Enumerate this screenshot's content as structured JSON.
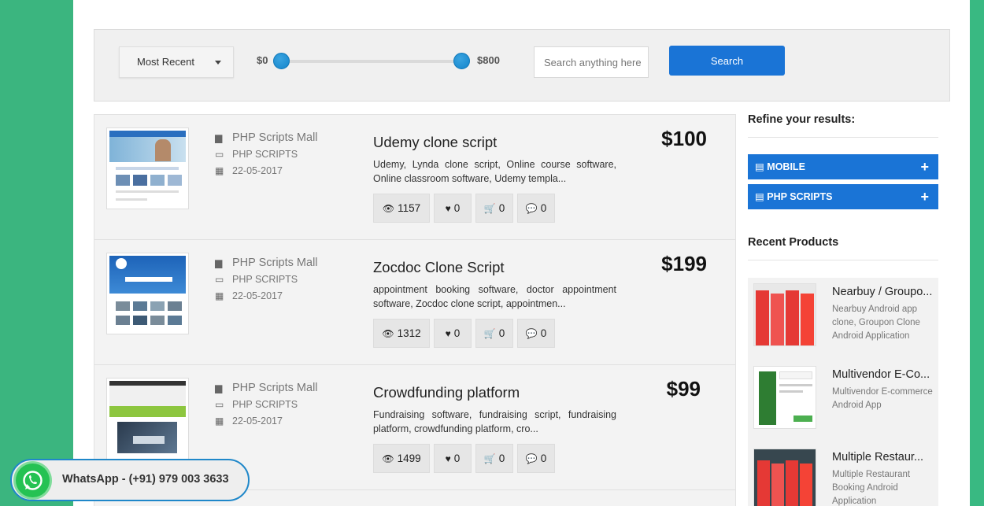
{
  "filters": {
    "sort_selected": "Most Recent",
    "price_min": "$0",
    "price_max": "$800",
    "price_range_fraction": [
      0,
      1
    ],
    "search_placeholder": "Search anything here",
    "search_button": "Search"
  },
  "products": [
    {
      "vendor": "PHP Scripts Mall",
      "category": "PHP SCRIPTS",
      "date": "22-05-2017",
      "title": "Udemy clone script",
      "description": "Udemy, Lynda clone script, Online course software, Online classroom software, Udemy templa...",
      "price": "$100",
      "views": "1157",
      "likes": "0",
      "cart": "0",
      "comments": "0"
    },
    {
      "vendor": "PHP Scripts Mall",
      "category": "PHP SCRIPTS",
      "date": "22-05-2017",
      "title": "Zocdoc Clone Script",
      "description": "appointment booking software, doctor appointment software, Zocdoc clone script, appointmen...",
      "price": "$199",
      "views": "1312",
      "likes": "0",
      "cart": "0",
      "comments": "0"
    },
    {
      "vendor": "PHP Scripts Mall",
      "category": "PHP SCRIPTS",
      "date": "22-05-2017",
      "title": "Crowdfunding platform",
      "description": "Fundraising software, fundraising script, fundraising platform, crowdfunding platform, cro...",
      "price": "$99",
      "views": "1499",
      "likes": "0",
      "cart": "0",
      "comments": "0"
    }
  ],
  "sidebar": {
    "refine_heading": "Refine your results:",
    "categories": [
      {
        "label": "MOBILE"
      },
      {
        "label": "PHP SCRIPTS"
      }
    ],
    "recent_heading": "Recent Products",
    "recent": [
      {
        "title": "Nearbuy / Groupo...",
        "description": "Nearbuy Android app clone, Groupon Clone Android Application"
      },
      {
        "title": "Multivendor E-Co...",
        "description": "Multivendor E-commerce Android App"
      },
      {
        "title": "Multiple Restaur...",
        "description": "Multiple Restaurant Booking Android Application"
      }
    ]
  },
  "whatsapp": {
    "label": "WhatsApp - (+91) 979 003 3633"
  },
  "colors": {
    "accent": "#1a74d6",
    "side_green": "#3bb57f",
    "whatsapp_green": "#25c253"
  }
}
